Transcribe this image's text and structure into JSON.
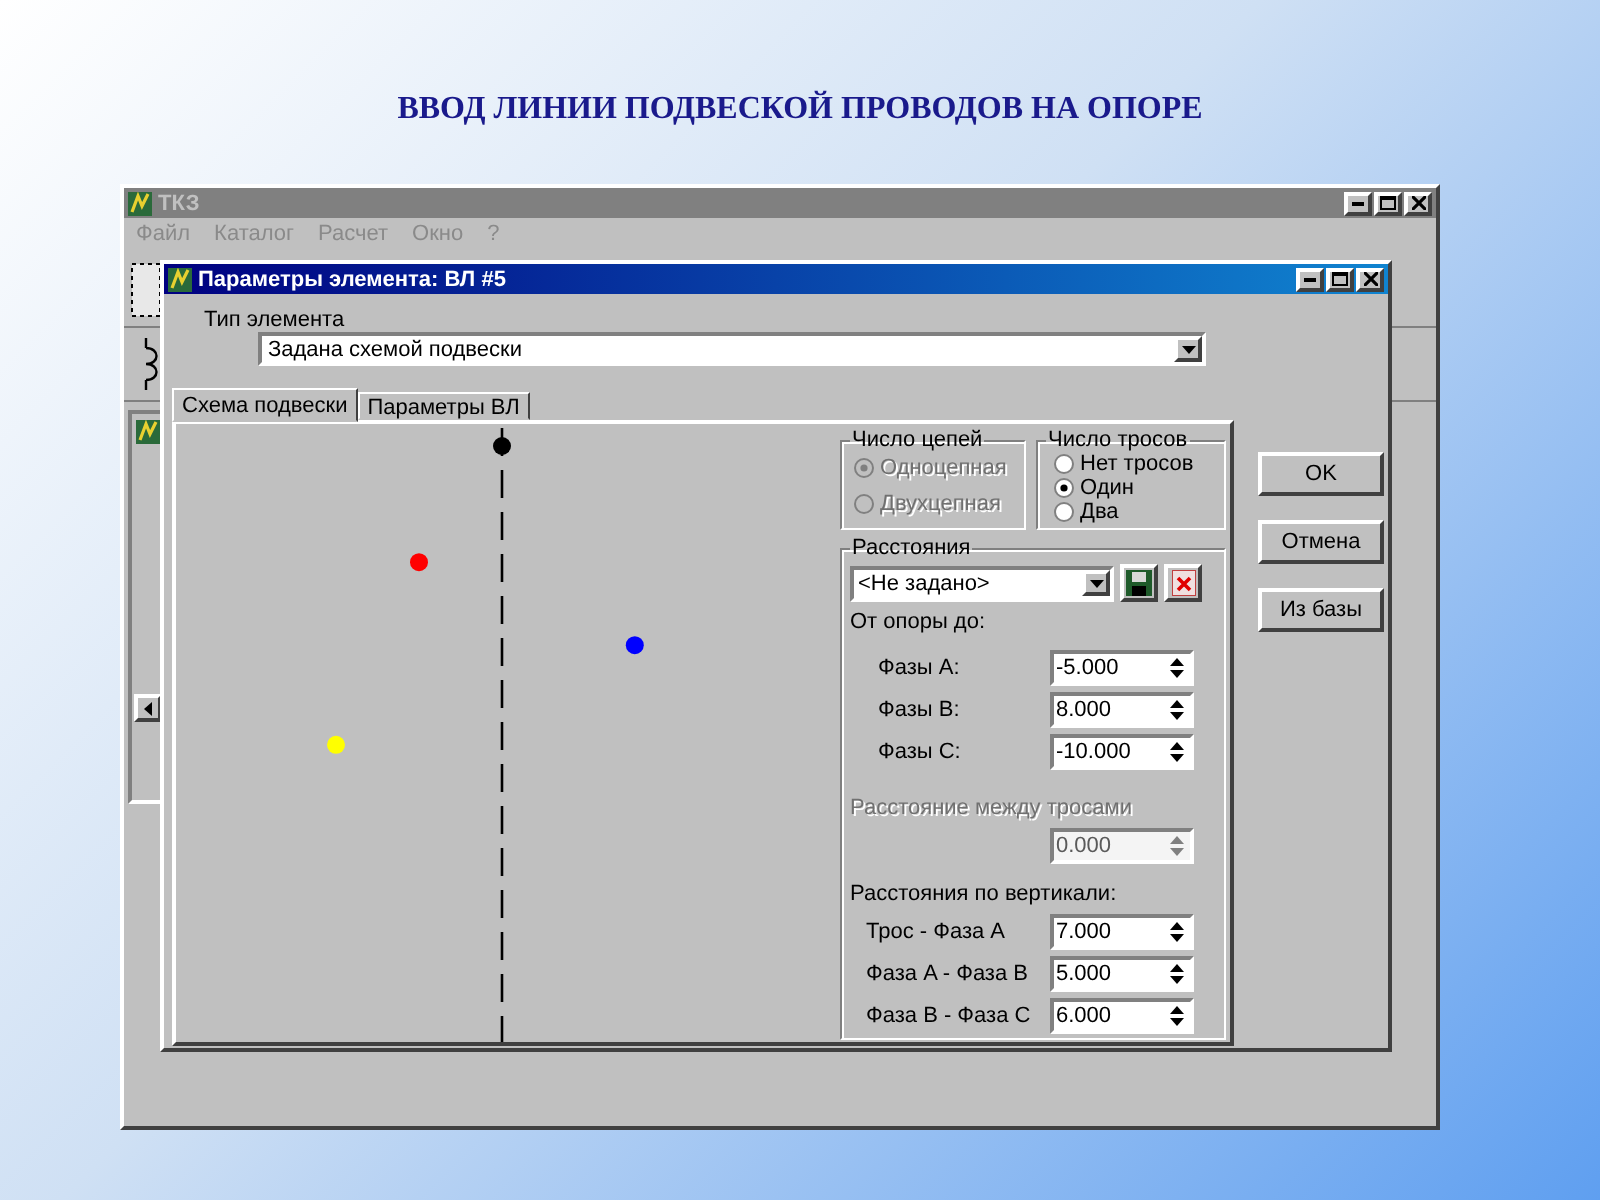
{
  "slide_title": "ВВОД ЛИНИИ ПОДВЕСКОЙ ПРОВОДОВ НА ОПОРЕ",
  "main_window": {
    "title": "ТКЗ",
    "menu": [
      {
        "label": "Файл",
        "disabled": true
      },
      {
        "label": "Каталог",
        "disabled": true
      },
      {
        "label": "Расчет",
        "disabled": true
      },
      {
        "label": "Окно",
        "disabled": true
      },
      {
        "label": "?",
        "disabled": true
      }
    ]
  },
  "dialog": {
    "title": "Параметры элемента: ВЛ #5",
    "element_type": {
      "label": "Тип элемента",
      "value": "Задана схемой подвески"
    },
    "tabs": [
      {
        "label": "Схема подвески",
        "selected": true
      },
      {
        "label": "Параметры ВЛ",
        "selected": false
      }
    ],
    "scheme": {
      "markers": [
        {
          "color": "#000000"
        },
        {
          "color": "#ff0000"
        },
        {
          "color": "#0000ff"
        },
        {
          "color": "#ffff00"
        }
      ]
    },
    "circuits": {
      "title": "Число цепей",
      "options": [
        {
          "label": "Одноцепная",
          "selected": true,
          "disabled": true
        },
        {
          "label": "Двухцепная",
          "selected": false,
          "disabled": true
        }
      ]
    },
    "cables": {
      "title": "Число тросов",
      "options": [
        {
          "label": "Нет тросов",
          "selected": false,
          "disabled": false
        },
        {
          "label": "Один",
          "selected": true,
          "disabled": false
        },
        {
          "label": "Два",
          "selected": false,
          "disabled": false
        }
      ]
    },
    "distances": {
      "title": "Расстояния",
      "preset": "<Не задано>",
      "from_pole_label": "От опоры до:",
      "from_pole": [
        {
          "label": "Фазы A:",
          "value": "-5.000"
        },
        {
          "label": "Фазы B:",
          "value": "8.000"
        },
        {
          "label": "Фазы C:",
          "value": "-10.000"
        }
      ],
      "between_cables": {
        "label": "Расстояние между тросами",
        "value": "0.000",
        "disabled": true
      },
      "vertical_label": "Расстояния по вертикали:",
      "vertical": [
        {
          "label": "Трос - Фаза A",
          "value": "7.000"
        },
        {
          "label": "Фаза A - Фаза B",
          "value": "5.000"
        },
        {
          "label": "Фаза B - Фаза C",
          "value": "6.000"
        }
      ]
    },
    "buttons": [
      "OK",
      "Отмена",
      "Из базы"
    ]
  }
}
